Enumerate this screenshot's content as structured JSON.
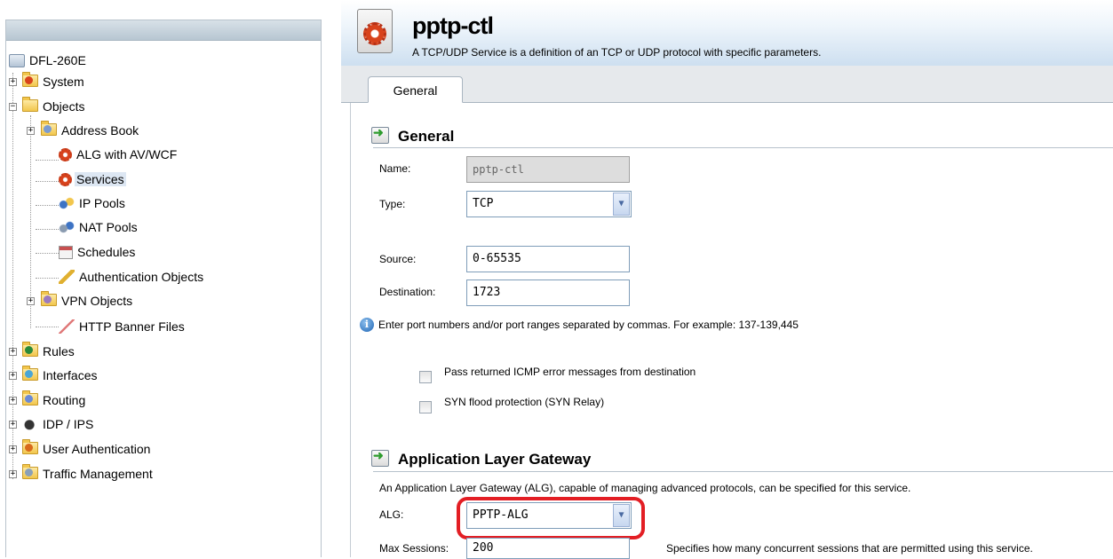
{
  "tree": {
    "root": "DFL-260E",
    "system": "System",
    "objects": "Objects",
    "address_book": "Address Book",
    "alg_av_wcf": "ALG with AV/WCF",
    "services": "Services",
    "ip_pools": "IP Pools",
    "nat_pools": "NAT Pools",
    "schedules": "Schedules",
    "auth_objects": "Authentication Objects",
    "vpn_objects": "VPN Objects",
    "http_banner": "HTTP Banner Files",
    "rules": "Rules",
    "interfaces": "Interfaces",
    "routing": "Routing",
    "idp_ips": "IDP / IPS",
    "user_auth": "User Authentication",
    "traffic_mgmt": "Traffic Management"
  },
  "header": {
    "title": "pptp-ctl",
    "subtitle": "A TCP/UDP Service is a definition of an TCP or UDP protocol with specific parameters."
  },
  "tabs": {
    "general": "General"
  },
  "general": {
    "heading": "General",
    "name_label": "Name:",
    "name_value": "pptp-ctl",
    "type_label": "Type:",
    "type_value": "TCP",
    "source_label": "Source:",
    "source_value": "0-65535",
    "destination_label": "Destination:",
    "destination_value": "1723",
    "hint": "Enter port numbers and/or port ranges separated by commas. For example: 137-139,445",
    "pass_icmp_label": "Pass returned ICMP error messages from destination",
    "syn_flood_label": "SYN flood protection (SYN Relay)"
  },
  "alg": {
    "heading": "Application Layer Gateway",
    "description": "An Application Layer Gateway (ALG), capable of managing advanced protocols, can be specified for this service.",
    "alg_label": "ALG:",
    "alg_value": "PPTP-ALG",
    "max_sessions_label": "Max Sessions:",
    "max_sessions_value": "200",
    "max_sessions_hint": "Specifies how many concurrent sessions that are permitted using this service."
  },
  "colors": {
    "highlight": "#e31e24",
    "selected_row": "#dde7f3",
    "header_gradient_end": "#cddff0"
  }
}
